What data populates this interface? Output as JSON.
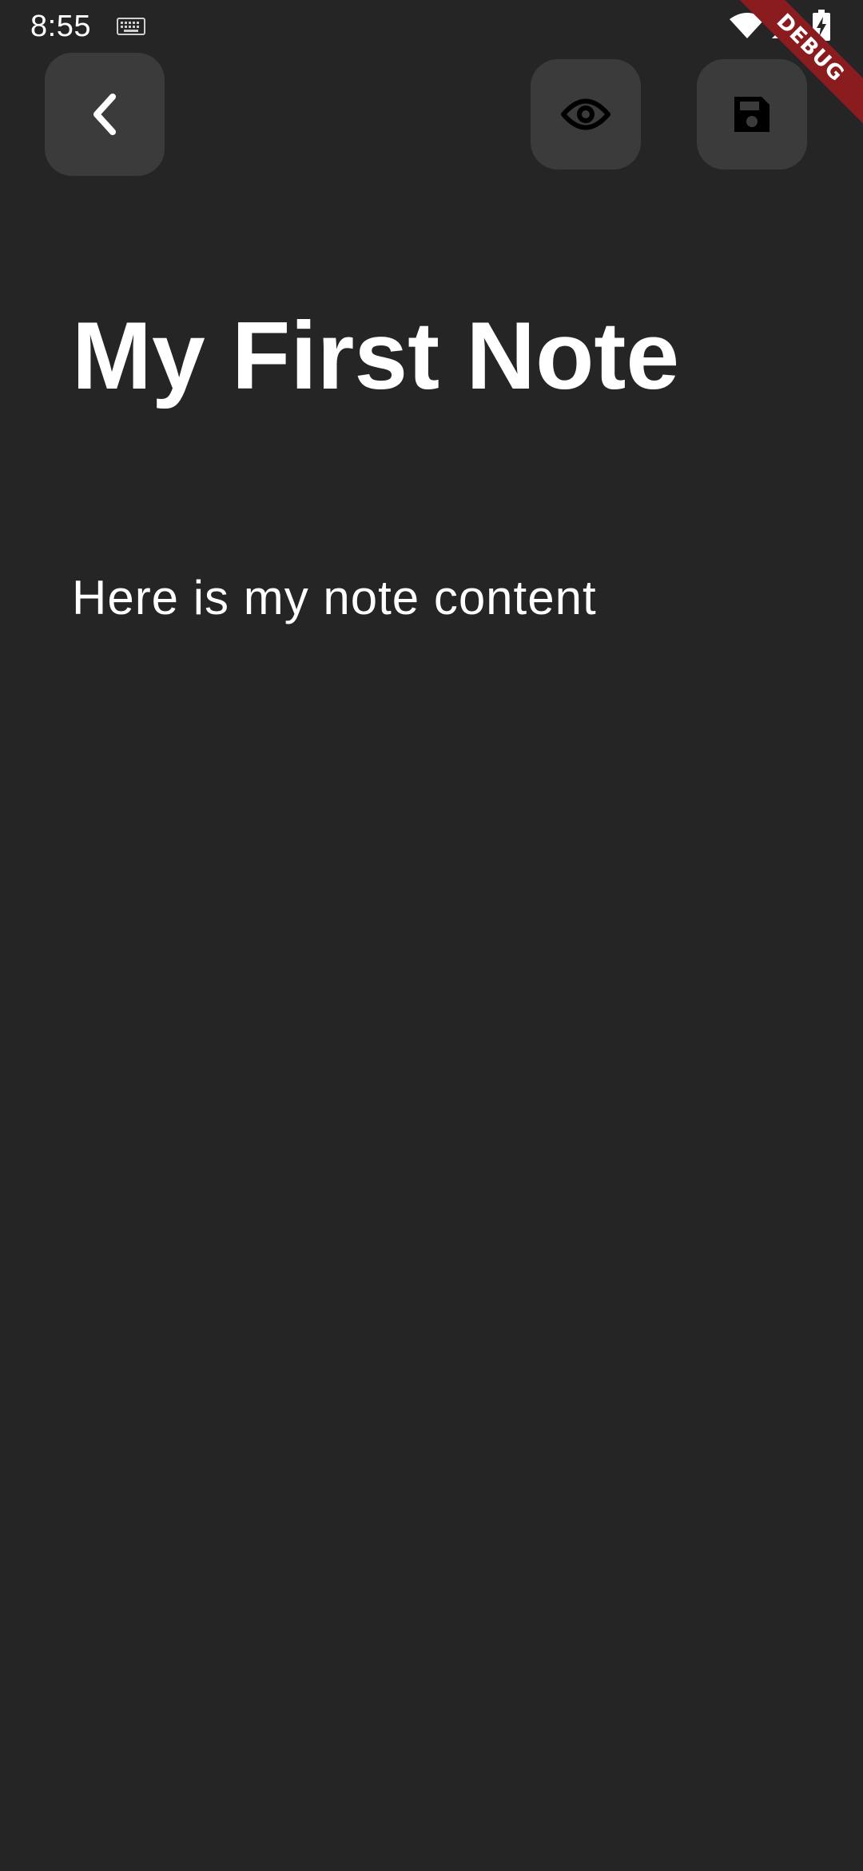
{
  "status_bar": {
    "time": "8:55",
    "icons": [
      "keyboard-icon",
      "wifi-icon",
      "signal-icon",
      "battery-charging-icon"
    ]
  },
  "debug_banner": {
    "label": "DEBUG",
    "color": "#8a1c1f"
  },
  "toolbar": {
    "back_icon": "chevron-left-icon",
    "preview_icon": "eye-icon",
    "save_icon": "floppy-disk-icon",
    "button_color": "#3b3b3b"
  },
  "note": {
    "title": "My First Note",
    "content": "Here is my note content"
  },
  "colors": {
    "background": "#252525",
    "text": "#ffffff"
  }
}
